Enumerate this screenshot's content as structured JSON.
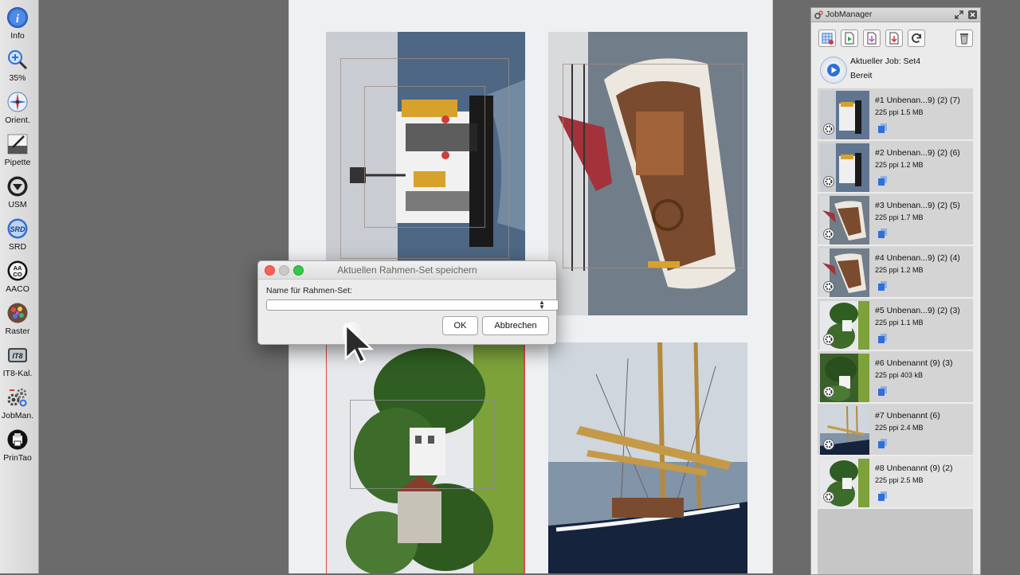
{
  "toolbar": {
    "items": [
      {
        "label": "Info",
        "icon": "info-icon"
      },
      {
        "label": "35%",
        "icon": "zoom-icon"
      },
      {
        "label": "Orient.",
        "icon": "orientation-icon"
      },
      {
        "label": "Pipette",
        "icon": "pipette-icon"
      },
      {
        "label": "USM",
        "icon": "usm-icon"
      },
      {
        "label": "SRD",
        "icon": "srd-icon"
      },
      {
        "label": "AACO",
        "icon": "aaco-icon"
      },
      {
        "label": "Raster",
        "icon": "raster-icon"
      },
      {
        "label": "IT8-Kal.",
        "icon": "it8-calibration-icon"
      },
      {
        "label": "JobMan.",
        "icon": "jobmanager-gears-icon"
      },
      {
        "label": "PrinTao",
        "icon": "printao-icon"
      }
    ],
    "it8_icon_text": "IT8",
    "aaco_icon_text": "AA\nCO",
    "srd_icon_text": "SRD"
  },
  "dialog": {
    "title": "Aktuellen Rahmen-Set speichern",
    "field_label": "Name für Rahmen-Set:",
    "field_value": "",
    "ok_label": "OK",
    "cancel_label": "Abbrechen"
  },
  "jobmanager": {
    "title": "JobManager",
    "current_job": "Aktueller Job: Set4",
    "status": "Bereit",
    "jobs": [
      {
        "name": "#1 Unbenan...9) (2) (7)",
        "meta": "225 ppi    1.5 MB"
      },
      {
        "name": "#2 Unbenan...9) (2) (6)",
        "meta": "225 ppi    1.2 MB"
      },
      {
        "name": "#3 Unbenan...9) (2) (5)",
        "meta": "225 ppi    1.7 MB"
      },
      {
        "name": "#4 Unbenan...9) (2) (4)",
        "meta": "225 ppi    1.2 MB"
      },
      {
        "name": "#5 Unbenan...9) (2) (3)",
        "meta": "225 ppi    1.1 MB"
      },
      {
        "name": "#6 Unbenannt (9) (3)",
        "meta": "225 ppi    403 kB"
      },
      {
        "name": "#7 Unbenannt (6)",
        "meta": "225 ppi    2.4 MB"
      },
      {
        "name": "#8 Unbenannt (9) (2)",
        "meta": "225 ppi    2.5 MB"
      }
    ]
  },
  "colors": {
    "accent_blue": "#2f6fd6",
    "traffic_red": "#fc5f57",
    "traffic_yellow": "#c9c9c9",
    "traffic_green": "#35c748"
  }
}
